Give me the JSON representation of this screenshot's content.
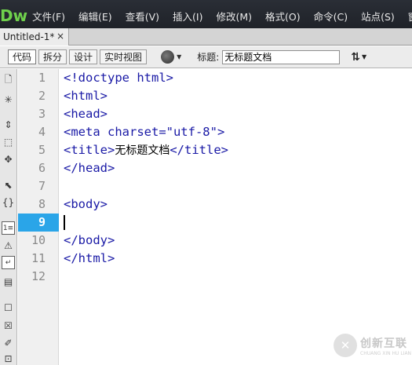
{
  "app": {
    "logo": "Dw"
  },
  "menu": [
    "文件(F)",
    "编辑(E)",
    "查看(V)",
    "插入(I)",
    "修改(M)",
    "格式(O)",
    "命令(C)",
    "站点(S)",
    "窗口"
  ],
  "tab": {
    "label": "Untitled-1*",
    "close": "×"
  },
  "toolbar": {
    "code": "代码",
    "split": "拆分",
    "design": "设计",
    "live_view": "实时视图",
    "title_label": "标题:",
    "title_value": "无标题文档"
  },
  "editor": {
    "current_line": 9,
    "line_numbers": [
      "1",
      "2",
      "3",
      "4",
      "5",
      "6",
      "7",
      "8",
      "9",
      "10",
      "11",
      "12"
    ],
    "lines": [
      {
        "tag": "<!doctype html>"
      },
      {
        "tag": "<html>"
      },
      {
        "tag": "<head>"
      },
      {
        "tag": "<meta charset=\"utf-8\">"
      },
      {
        "open": "<title>",
        "text": "无标题文档",
        "close": "</title>"
      },
      {
        "tag": "</head>"
      },
      {
        "tag": ""
      },
      {
        "tag": "<body>"
      },
      {
        "tag": ""
      },
      {
        "tag": "</body>"
      },
      {
        "tag": "</html>"
      },
      {
        "tag": ""
      }
    ]
  },
  "watermark": {
    "cn": "创新互联",
    "en": "CHUANG XIN HU LIAN"
  },
  "colors": {
    "menubar": "#23262c",
    "logo": "#6fd04c",
    "active_line": "#2aa5e8",
    "code_tag": "#1a1aa6"
  }
}
